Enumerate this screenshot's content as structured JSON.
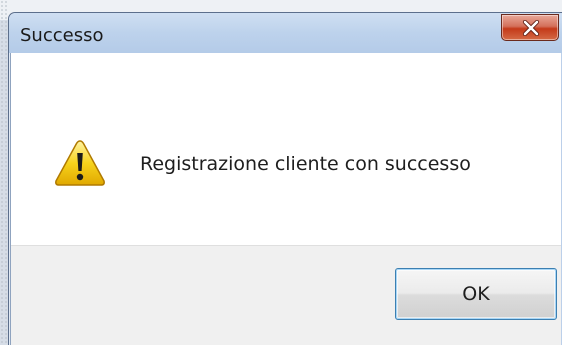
{
  "dialog": {
    "title": "Successo",
    "close_icon": "close-icon",
    "warning_icon": "warning-triangle-icon",
    "message": "Registrazione cliente con successo",
    "ok_label": "OK"
  },
  "colors": {
    "close_button": "#c43a1a",
    "ok_border": "#3c7fb1",
    "warning": "#f2c200"
  }
}
